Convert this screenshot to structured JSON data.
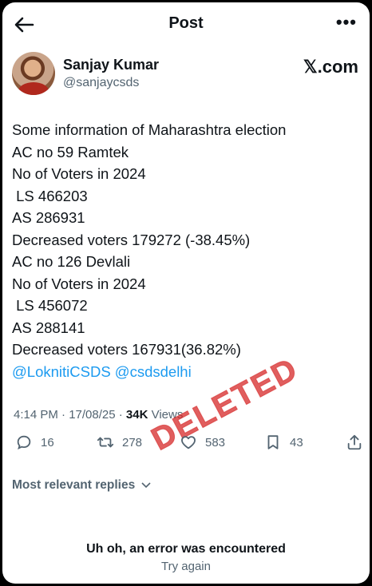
{
  "header": {
    "title": "Post",
    "back_icon": "arrow-left-icon",
    "more_icon": "more-horizontal-icon",
    "more_label": "•••"
  },
  "author": {
    "name": "Sanjay Kumar",
    "handle": "@sanjaycsds",
    "brand": "𝕏.com"
  },
  "post": {
    "lines": [
      "Some information of Maharashtra election",
      "AC no 59 Ramtek",
      "No of Voters in 2024",
      " LS 466203",
      "AS 286931",
      "Decreased voters 179272 (-38.45%)",
      "AC no 126 Devlali",
      "No of Voters in 2024",
      " LS 456072",
      "AS 288141",
      "Decreased voters 167931(36.82%)"
    ],
    "mentions": "@LoknitiCSDS @csdsdelhi"
  },
  "meta": {
    "time": "4:14 PM · 17/08/25 · ",
    "views_count": "34K",
    "views_label": " Views"
  },
  "stamp": {
    "text": "DELETED",
    "color": "#d62828"
  },
  "actions": {
    "replies": "16",
    "reposts": "278",
    "likes": "583",
    "bookmarks": "43"
  },
  "replies_sort": "Most relevant replies",
  "error": {
    "message": "Uh oh, an error was encountered",
    "retry": "Try again"
  },
  "colors": {
    "link": "#1d9bf0",
    "muted": "#536471",
    "text": "#0f1419"
  }
}
